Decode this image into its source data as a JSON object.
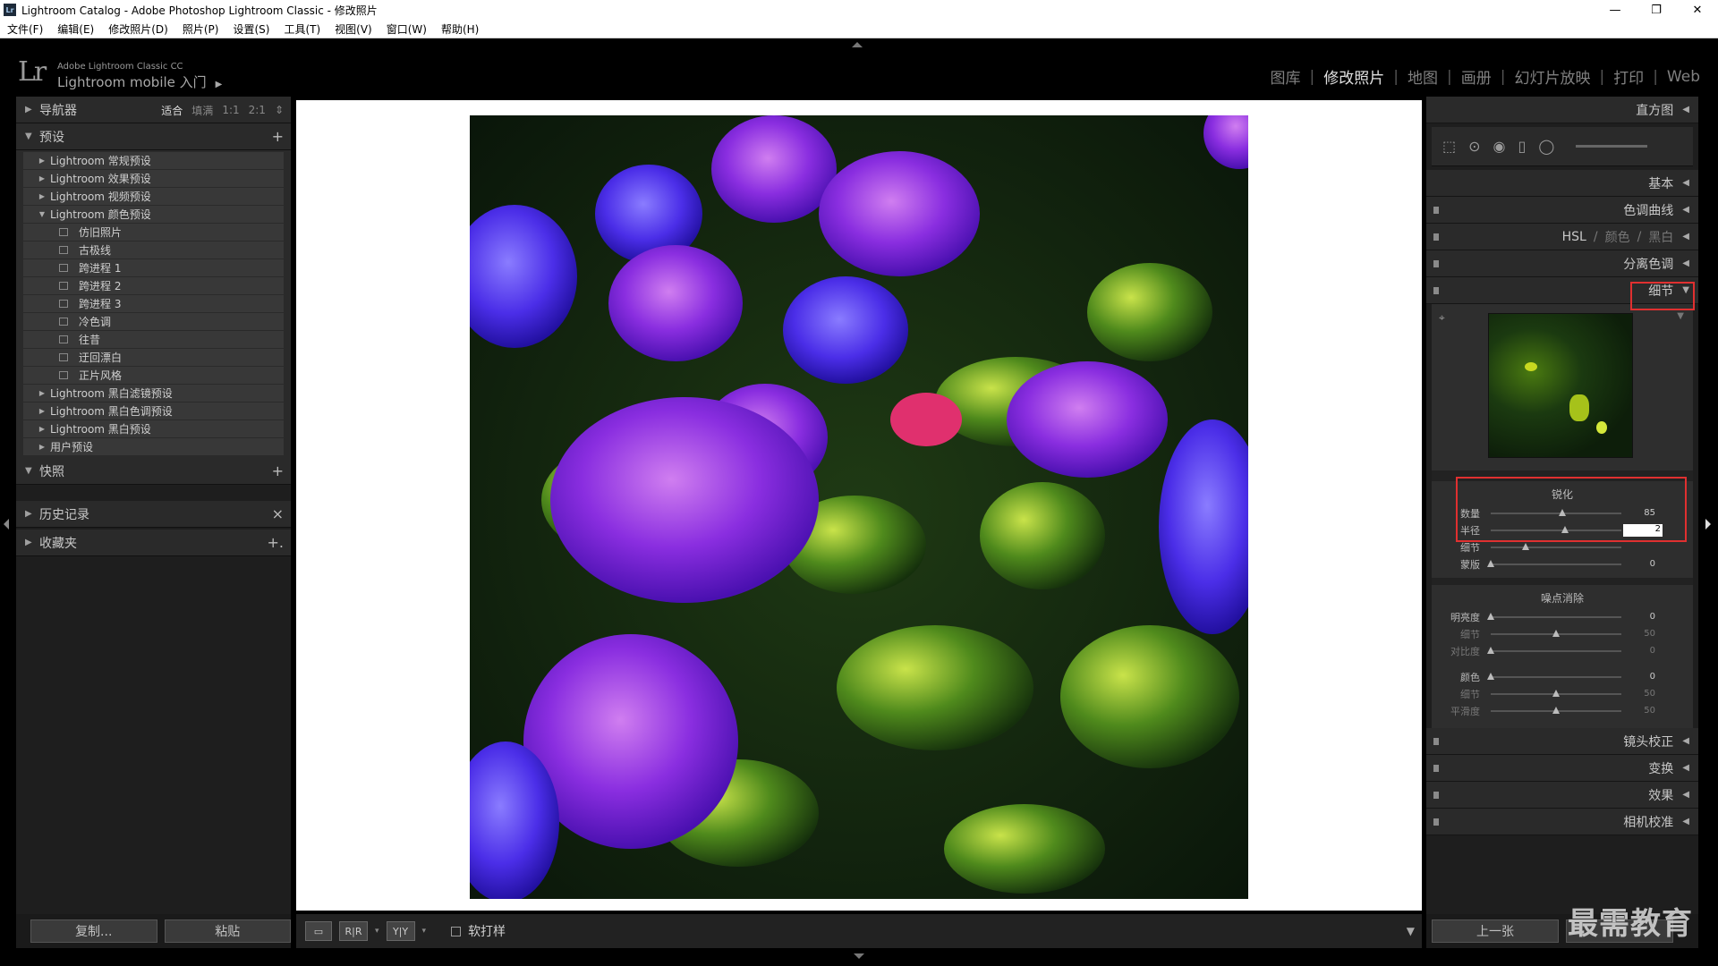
{
  "window": {
    "title": "Lightroom Catalog - Adobe Photoshop Lightroom Classic - 修改照片",
    "app_icon": "Lr",
    "minimize": "—",
    "restore": "❐",
    "close": "✕"
  },
  "menu": [
    "文件(F)",
    "编辑(E)",
    "修改照片(D)",
    "照片(P)",
    "设置(S)",
    "工具(T)",
    "视图(V)",
    "窗口(W)",
    "帮助(H)"
  ],
  "identity": {
    "logo": "Lr",
    "small": "Adobe Lightroom Classic CC",
    "main": "Lightroom mobile 入门",
    "play": "▶"
  },
  "modules": [
    {
      "label": "图库",
      "active": false
    },
    {
      "label": "修改照片",
      "active": true
    },
    {
      "label": "地图",
      "active": false
    },
    {
      "label": "画册",
      "active": false
    },
    {
      "label": "幻灯片放映",
      "active": false
    },
    {
      "label": "打印",
      "active": false
    },
    {
      "label": "Web",
      "active": false
    }
  ],
  "left": {
    "navigator": {
      "label": "导航器",
      "opts": [
        "适合",
        "填满",
        "1:1",
        "2:1"
      ]
    },
    "presets": {
      "label": "预设",
      "items": [
        {
          "label": "Lightroom 常规预设",
          "type": "folder",
          "open": false
        },
        {
          "label": "Lightroom 效果预设",
          "type": "folder",
          "open": false
        },
        {
          "label": "Lightroom 视频预设",
          "type": "folder",
          "open": false
        },
        {
          "label": "Lightroom 颜色预设",
          "type": "folder",
          "open": true
        },
        {
          "label": "仿旧照片",
          "type": "child"
        },
        {
          "label": "古极线",
          "type": "child"
        },
        {
          "label": "跨进程 1",
          "type": "child"
        },
        {
          "label": "跨进程 2",
          "type": "child"
        },
        {
          "label": "跨进程 3",
          "type": "child"
        },
        {
          "label": "冷色调",
          "type": "child"
        },
        {
          "label": "往昔",
          "type": "child"
        },
        {
          "label": "迂回漂白",
          "type": "child"
        },
        {
          "label": "正片风格",
          "type": "child"
        },
        {
          "label": "Lightroom 黑白滤镜预设",
          "type": "folder",
          "open": false
        },
        {
          "label": "Lightroom 黑白色调预设",
          "type": "folder",
          "open": false
        },
        {
          "label": "Lightroom 黑白预设",
          "type": "folder",
          "open": false
        },
        {
          "label": "用户预设",
          "type": "folder",
          "open": false
        }
      ]
    },
    "snapshots": {
      "label": "快照"
    },
    "history": {
      "label": "历史记录"
    },
    "collections": {
      "label": "收藏夹"
    },
    "copy_button": "复制...",
    "paste_button": "粘贴"
  },
  "toolbar": {
    "soft_proof": "软打样",
    "compare1": "R|R",
    "compare2": "Y|Y"
  },
  "right": {
    "histogram": "直方图",
    "basic": "基本",
    "tone_curve": "色调曲线",
    "hsl": {
      "a": "HSL",
      "b": "颜色",
      "c": "黑白",
      "sep": "/"
    },
    "split_toning": "分离色调",
    "detail": "细节",
    "sharpening": {
      "title": "锐化",
      "rows": [
        {
          "label": "数量",
          "value": "85",
          "pos": 0.55
        },
        {
          "label": "半径",
          "value": "2",
          "pos": 0.57,
          "editing": true
        },
        {
          "label": "细节",
          "value": "",
          "pos": 0.27
        },
        {
          "label": "蒙版",
          "value": "0",
          "pos": 0.0
        }
      ]
    },
    "noise": {
      "title": "噪点消除",
      "rows": [
        {
          "label": "明亮度",
          "value": "0",
          "pos": 0.0,
          "dim": false
        },
        {
          "label": "细节",
          "value": "50",
          "pos": 0.5,
          "dim": true
        },
        {
          "label": "对比度",
          "value": "0",
          "pos": 0.0,
          "dim": true
        },
        {
          "label": "颜色",
          "value": "0",
          "pos": 0.0,
          "dim": false
        },
        {
          "label": "细节",
          "value": "50",
          "pos": 0.5,
          "dim": true
        },
        {
          "label": "平滑度",
          "value": "50",
          "pos": 0.5,
          "dim": true
        }
      ]
    },
    "lens": "镜头校正",
    "transform": "变换",
    "effects": "效果",
    "calibration": "相机校准",
    "prev_button": "上一张",
    "watermark": "最需教育"
  },
  "colors": {
    "accent_red": "#e03030",
    "panel": "#2a2a2a",
    "bg": "#1e1e1e"
  }
}
